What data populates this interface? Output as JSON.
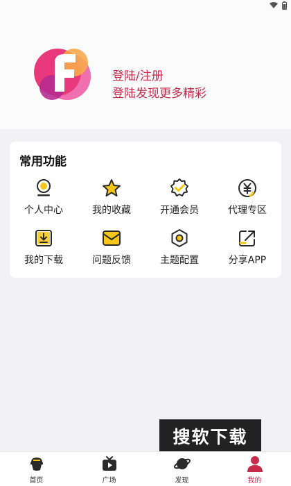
{
  "login": {
    "title": "登陆/注册",
    "subtitle": "登陆发现更多精彩"
  },
  "functions": {
    "section_title": "常用功能",
    "items": [
      {
        "label": "个人中心",
        "icon": "user-center-icon"
      },
      {
        "label": "我的收藏",
        "icon": "star-icon"
      },
      {
        "label": "开通会员",
        "icon": "vip-badge-icon"
      },
      {
        "label": "代理专区",
        "icon": "yuan-icon"
      },
      {
        "label": "我的下载",
        "icon": "download-icon"
      },
      {
        "label": "问题反馈",
        "icon": "feedback-icon"
      },
      {
        "label": "主题配置",
        "icon": "theme-icon"
      },
      {
        "label": "分享APP",
        "icon": "share-icon"
      }
    ]
  },
  "watermark": "搜软下载",
  "tabbar": {
    "items": [
      {
        "label": "首页",
        "icon": "home-icon"
      },
      {
        "label": "广场",
        "icon": "tv-icon"
      },
      {
        "label": "发现",
        "icon": "planet-icon"
      },
      {
        "label": "我的",
        "icon": "profile-icon"
      }
    ],
    "active_index": 3
  },
  "colors": {
    "accent": "#c72a4a",
    "icon_yellow": "#f5c518",
    "icon_dark": "#2a2a2a"
  }
}
